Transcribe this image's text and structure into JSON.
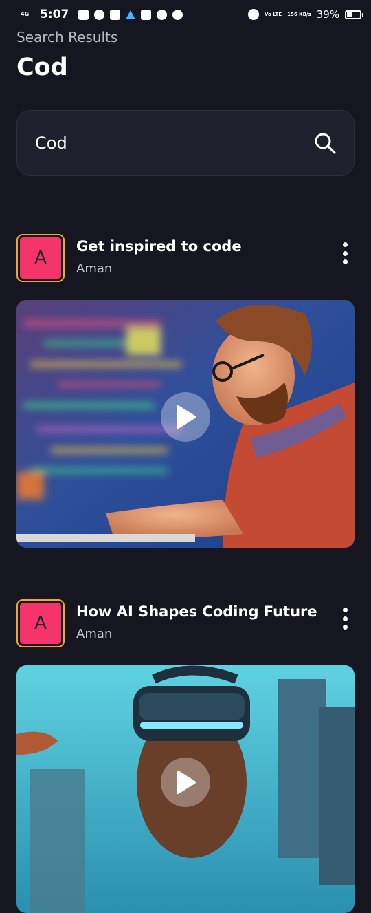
{
  "status_bar": {
    "network": "4G",
    "time": "5:07",
    "volte": "Vo LTE",
    "speed": "156 KB/s",
    "battery_percent": "39%",
    "battery_level": 0.39
  },
  "header": {
    "subtitle": "Search Results",
    "title": "Cod"
  },
  "search": {
    "value": "Cod",
    "icon": "search-icon"
  },
  "results": [
    {
      "avatar_letter": "A",
      "title": "Get inspired to code",
      "author": "Aman",
      "more_icon": "more-vertical-icon",
      "play_icon": "play-icon"
    },
    {
      "avatar_letter": "A",
      "title": "How AI Shapes Coding Future",
      "author": "Aman",
      "more_icon": "more-vertical-icon",
      "play_icon": "play-icon"
    }
  ],
  "colors": {
    "background": "#161620",
    "avatar_fill": "#f4346a",
    "avatar_border": "#f3a533"
  }
}
